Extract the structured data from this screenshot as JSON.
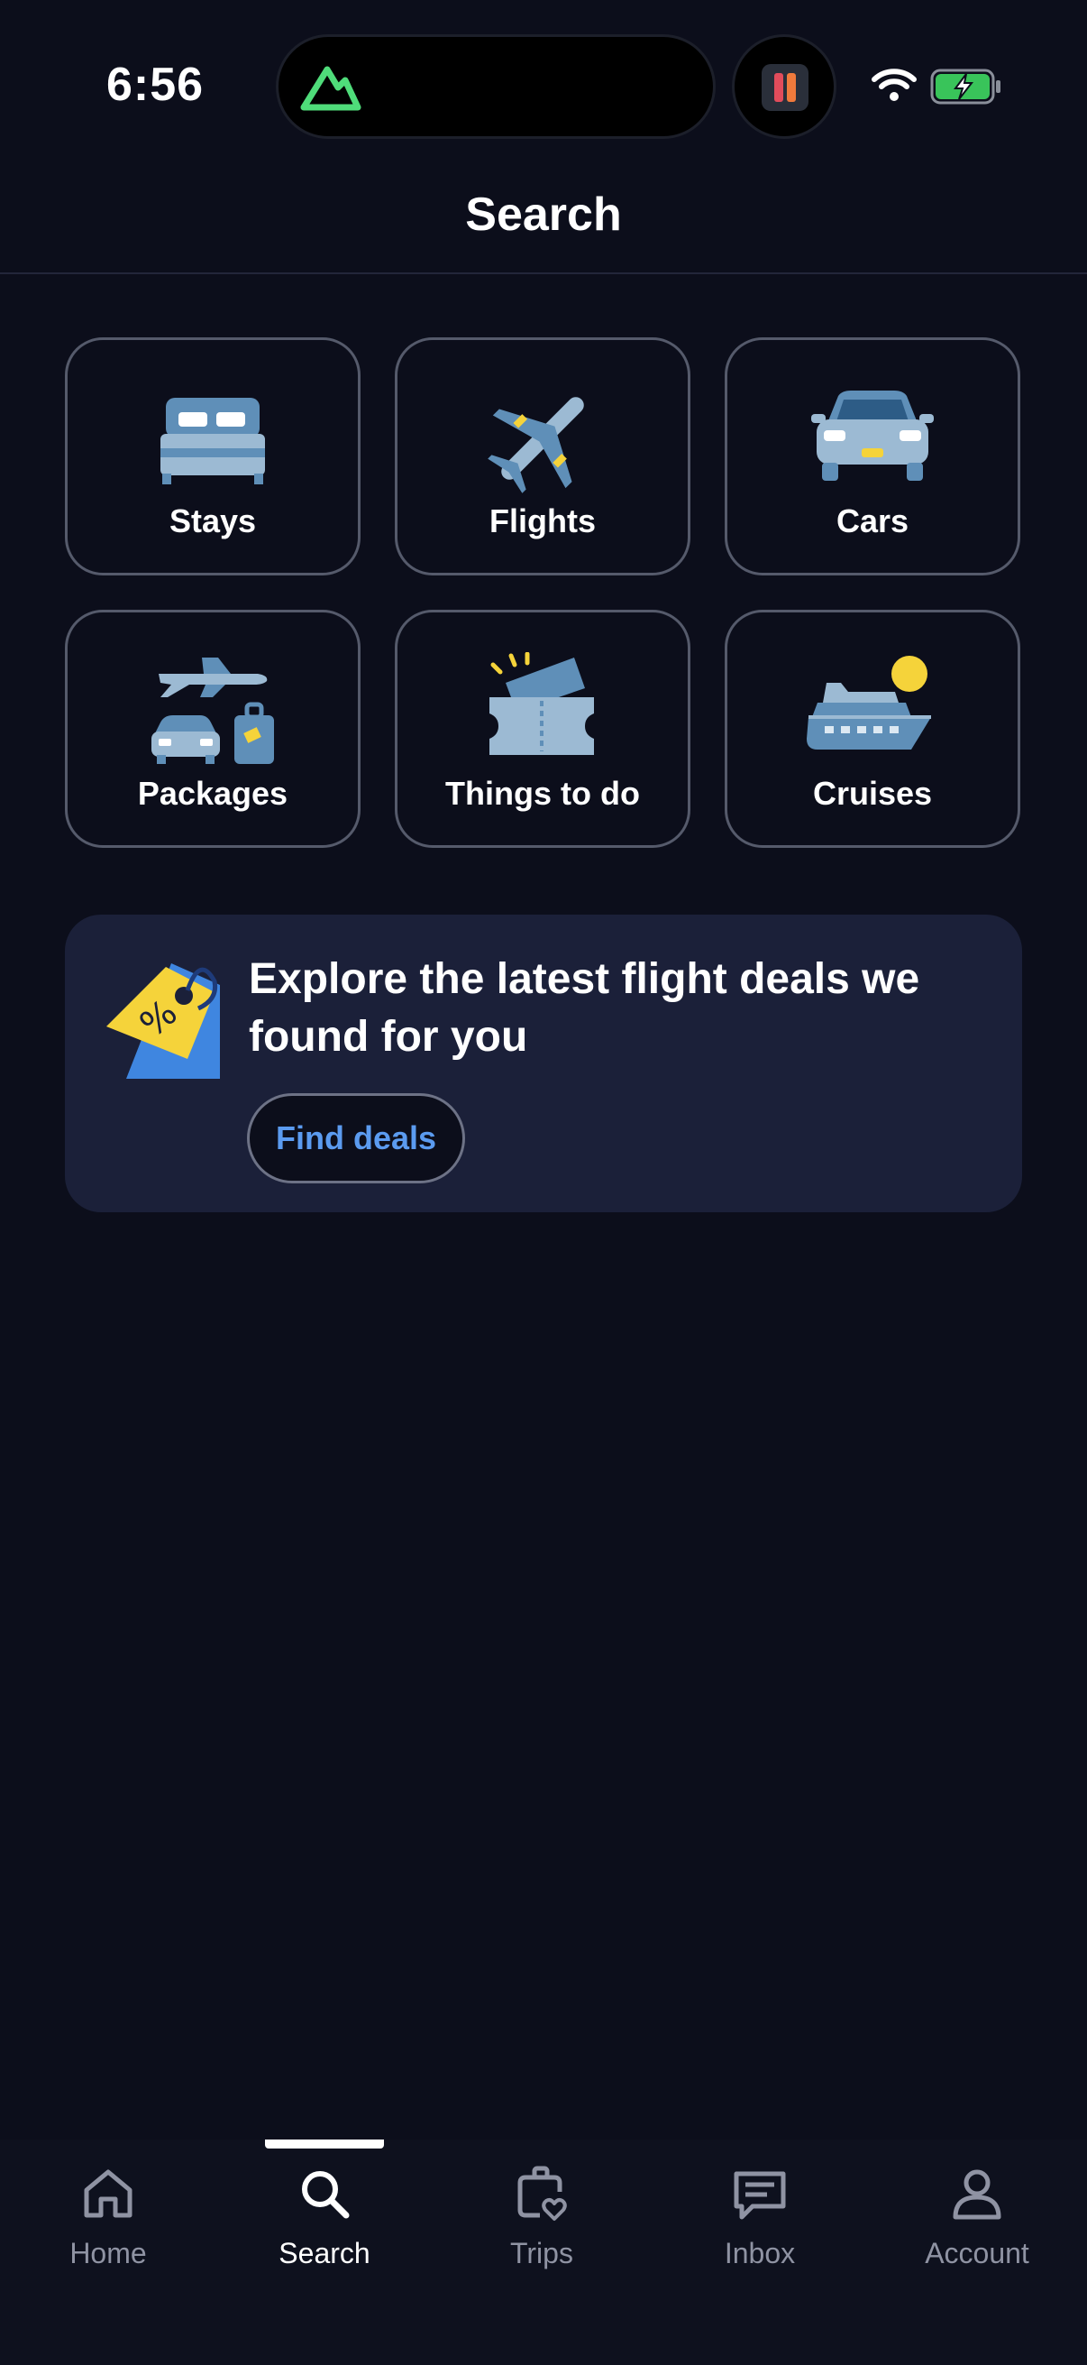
{
  "status_bar": {
    "time": "6:56"
  },
  "header": {
    "title": "Search"
  },
  "categories": [
    {
      "label": "Stays",
      "icon": "bed-icon"
    },
    {
      "label": "Flights",
      "icon": "airplane-icon"
    },
    {
      "label": "Cars",
      "icon": "car-icon"
    },
    {
      "label": "Packages",
      "icon": "package-icon"
    },
    {
      "label": "Things to do",
      "icon": "ticket-icon"
    },
    {
      "label": "Cruises",
      "icon": "cruise-ship-icon"
    }
  ],
  "promo": {
    "headline": "Explore the latest flight deals we found for you",
    "button_label": "Find deals",
    "icon": "price-tag-icon"
  },
  "tabbar": {
    "active": "Search",
    "tabs": [
      {
        "label": "Home",
        "icon": "home-icon"
      },
      {
        "label": "Search",
        "icon": "search-icon"
      },
      {
        "label": "Trips",
        "icon": "trips-icon"
      },
      {
        "label": "Inbox",
        "icon": "inbox-icon"
      },
      {
        "label": "Account",
        "icon": "account-icon"
      }
    ]
  },
  "colors": {
    "background": "#0c0e1b",
    "card": "#1b2039",
    "accent_link": "#5b9bf0",
    "icon_blue": "#5f8fb8",
    "icon_light": "#9cbad3",
    "icon_yellow": "#f5d33a"
  }
}
